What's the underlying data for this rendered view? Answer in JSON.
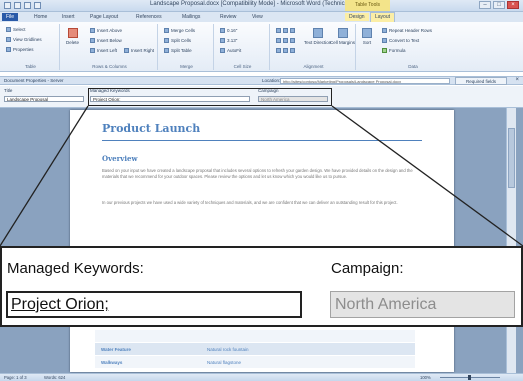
{
  "window": {
    "title": "Landscape Proposal.docx [Compatibility Mode] - Microsoft Word (Technical Preview)",
    "context_tab_group": "Table Tools"
  },
  "ribbon_tabs": [
    "File",
    "Home",
    "Insert",
    "Page Layout",
    "References",
    "Mailings",
    "Review",
    "View",
    "Design",
    "Layout"
  ],
  "ribbon_groups": [
    {
      "name": "Table",
      "items": [
        "Select",
        "View Gridlines",
        "Properties"
      ]
    },
    {
      "name": "Rows & Columns",
      "items": [
        "Delete",
        "Insert Above",
        "Insert Below",
        "Insert Left",
        "Insert Right"
      ]
    },
    {
      "name": "Merge",
      "items": [
        "Merge Cells",
        "Split Cells",
        "Split Table"
      ]
    },
    {
      "name": "Cell Size",
      "items": [
        "AutoFit",
        "0.16\"",
        "3.13\""
      ]
    },
    {
      "name": "Alignment",
      "items": [
        "Text Direction",
        "Cell Margins"
      ]
    },
    {
      "name": "Data",
      "items": [
        "Sort",
        "Repeat Header Rows",
        "Convert to Text",
        "Formula"
      ]
    }
  ],
  "dip": {
    "header": "Document Properties - Server",
    "location_label": "Location:",
    "location_value": "http://sites/contoso/Marketing/Proposals/Landscape Proposal.docx",
    "required_label": "Required fields",
    "close": "×",
    "title_label": "Title",
    "title_value": "Landscape Proposal",
    "keywords_label": "Managed Keywords",
    "keywords_value": "Project Orion;",
    "campaign_label": "Campaign",
    "campaign_value": "North America"
  },
  "document": {
    "title": "Product Launch",
    "heading": "Overview",
    "para1": "Based on your input we have created a landscape proposal that includes several options to refresh your garden design. We have provided details on the design and the materials that we recommend for your outdoor spaces. Please review the options and let us know which you would like us to pursue.",
    "para2": "In our previous projects we have used a wide variety of techniques and materials, and we are confident that we can deliver an outstanding result for this project."
  },
  "zoom": {
    "keywords_label": "Managed Keywords:",
    "keywords_value": "Project Orion;",
    "campaign_label": "Campaign:",
    "campaign_value": "North America"
  },
  "table_rows": [
    {
      "key": "Water Feature",
      "value": "Natural rock fountain"
    },
    {
      "key": "Walkways",
      "value": "Natural flagstone"
    }
  ],
  "status": {
    "page": "Page: 1 of 3",
    "words": "Words: 624",
    "zoom": "100%"
  }
}
